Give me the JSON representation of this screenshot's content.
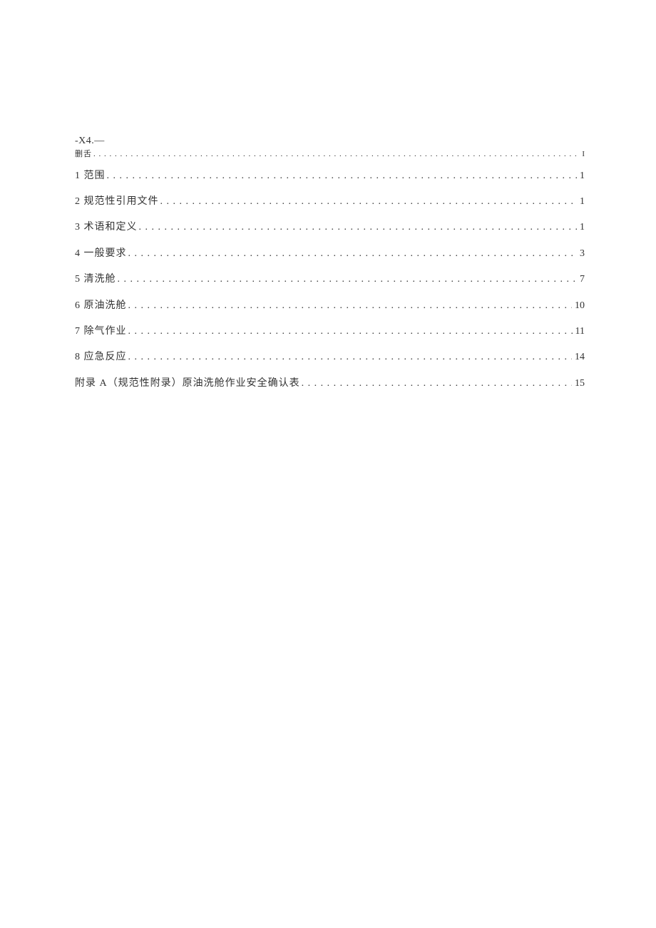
{
  "header": "-X4.—",
  "toc": [
    {
      "label": "删舌",
      "page": "I",
      "small": true
    },
    {
      "label": "1 范围",
      "page": "1"
    },
    {
      "label": "2 规范性引用文件",
      "page": "1"
    },
    {
      "label": "3 术语和定义",
      "page": "1"
    },
    {
      "label": "4 一般要求",
      "page": "3"
    },
    {
      "label": "5 清洗舱",
      "page": "7"
    },
    {
      "label": "6 原油洗舱",
      "page": "10"
    },
    {
      "label": "7 除气作业",
      "page": "11"
    },
    {
      "label": "8 应急反应",
      "page": "14"
    },
    {
      "label": "附录 A（规范性附录）原油洗舱作业安全确认表",
      "page": "15"
    }
  ]
}
